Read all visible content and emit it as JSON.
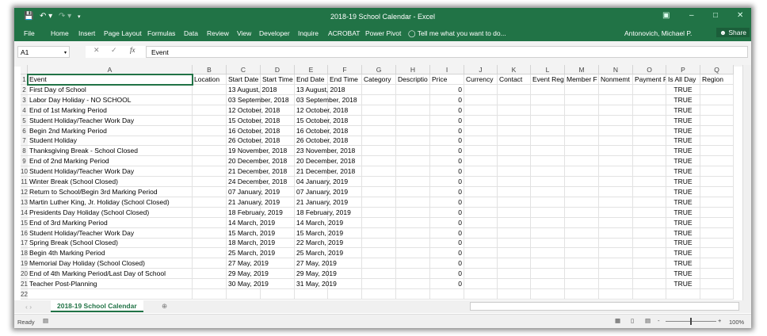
{
  "window": {
    "title": "2018-19 School Calendar - Excel",
    "user": "Antonovich, Michael P.",
    "share": "Share"
  },
  "ribbon": {
    "tabs": [
      "File",
      "Home",
      "Insert",
      "Page Layout",
      "Formulas",
      "Data",
      "Review",
      "View",
      "Developer",
      "Inquire",
      "ACROBAT",
      "Power Pivot"
    ],
    "tell_me": "Tell me what you want to do..."
  },
  "formula_bar": {
    "name_box": "A1",
    "content": "Event"
  },
  "columns": [
    "A",
    "B",
    "C",
    "D",
    "E",
    "F",
    "G",
    "H",
    "I",
    "J",
    "K",
    "L",
    "M",
    "N",
    "O",
    "P",
    "Q"
  ],
  "headers": [
    "Event",
    "Location",
    "Start Date",
    "Start Time",
    "End Date",
    "End Time",
    "Category",
    "Descriptio",
    "Price",
    "Currency",
    "Contact",
    "Event Regi",
    "Member F",
    "Nonmemt",
    "Payment F",
    "Is All Day",
    "Region"
  ],
  "rows": [
    [
      "First Day of School",
      "13 August, 2018",
      "13 August, 2018"
    ],
    [
      "Labor Day Holiday - NO SCHOOL",
      "03 September, 2018",
      "03 September, 2018"
    ],
    [
      "End of 1st Marking Period",
      "12 October, 2018",
      "12 October, 2018"
    ],
    [
      "Student Holiday/Teacher Work Day",
      "15 October, 2018",
      "15 October, 2018"
    ],
    [
      "Begin 2nd Marking Period",
      "16 October, 2018",
      "16 October, 2018"
    ],
    [
      "Student Holiday",
      "26 October, 2018",
      "26 October, 2018"
    ],
    [
      "Thanksgiving Break - School Closed",
      "19 November, 2018",
      "23 November, 2018"
    ],
    [
      "End of 2nd Marking Period",
      "20 December, 2018",
      "20 December, 2018"
    ],
    [
      "Student Holiday/Teacher Work Day",
      "21 December, 2018",
      "21 December, 2018"
    ],
    [
      "Winter Break (School Closed)",
      "24 December, 2018",
      "04 January, 2019"
    ],
    [
      "Return to School/Begin 3rd Marking Period",
      "07 January, 2019",
      "07 January, 2019"
    ],
    [
      "Martin Luther King, Jr. Holiday (School Closed)",
      "21 January, 2019",
      "21 January, 2019"
    ],
    [
      "Presidents Day Holiday (School Closed)",
      "18 February, 2019",
      "18 February, 2019"
    ],
    [
      "End of 3rd Marking Period",
      "14 March, 2019",
      "14 March, 2019"
    ],
    [
      "Student Holiday/Teacher Work Day",
      "15 March, 2019",
      "15 March, 2019"
    ],
    [
      "Spring Break (School Closed)",
      "18 March, 2019",
      "22 March, 2019"
    ],
    [
      "Begin 4th Marking Period",
      "25 March, 2019",
      "25 March, 2019"
    ],
    [
      "Memorial Day Holiday (School Closed)",
      "27 May, 2019",
      "27 May, 2019"
    ],
    [
      "End of 4th Marking Period/Last Day of School",
      "29 May, 2019",
      "29 May, 2019"
    ],
    [
      "Teacher Post-Planning",
      "30 May, 2019",
      "31 May, 2019"
    ]
  ],
  "price": "0",
  "all_day": "TRUE",
  "row_numbers": [
    "1",
    "2",
    "3",
    "4",
    "5",
    "6",
    "7",
    "8",
    "9",
    "10",
    "11",
    "12",
    "13",
    "14",
    "15",
    "16",
    "17",
    "18",
    "19",
    "20",
    "21",
    "22"
  ],
  "sheet_tab": "2018-19 School Calendar",
  "status": {
    "ready": "Ready",
    "zoom": "100%"
  },
  "colors": {
    "accent": "#217346"
  }
}
